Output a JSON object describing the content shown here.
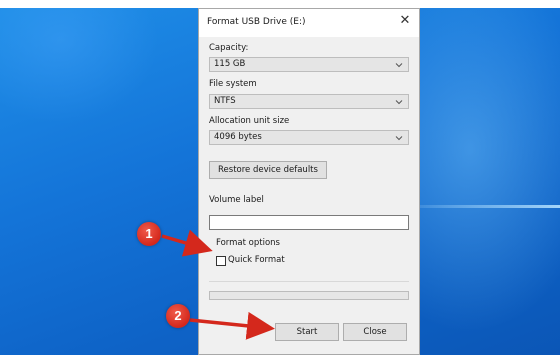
{
  "dialog": {
    "title": "Format USB Drive (E:)",
    "close_symbol": "✕",
    "capacity_label": "Capacity:",
    "capacity_value": "115 GB",
    "filesystem_label": "File system",
    "filesystem_value": "NTFS",
    "alloc_label": "Allocation unit size",
    "alloc_value": "4096 bytes",
    "restore_label": "Restore device defaults",
    "volume_label": "Volume label",
    "volume_value": "",
    "format_options_label": "Format options",
    "quick_format_label": "Quick Format",
    "quick_format_checked": false,
    "progress": 0,
    "start_label": "Start",
    "close_label": "Close"
  },
  "annotations": {
    "marker_1": "1",
    "marker_2": "2",
    "color": "#d4281c"
  },
  "icons": {
    "combo_arrow": "chevron-down-icon",
    "close": "close-icon"
  }
}
